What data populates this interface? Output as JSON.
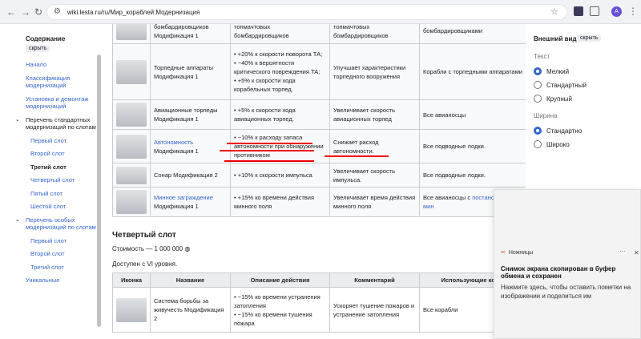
{
  "browser": {
    "url": "wiki.lesta.ru/ru/Мир_кораблей:Модернизация",
    "profile": "A"
  },
  "sidebar": {
    "title": "Содержание",
    "hide": "скрыть",
    "items": [
      "Начало",
      "Классификация модернизаций",
      "Установка и демонтаж модернизаций",
      "Перечень стандартных модернизаций по слотам",
      "Первый слот",
      "Второй слот",
      "Третий слот",
      "Четвертый слот",
      "Пятый слот",
      "Шестой слот",
      "Перечень особых модернизаций по слотам",
      "Первый слот",
      "Второй слот",
      "Третий слот",
      "Уникальные"
    ]
  },
  "table1": {
    "rows": [
      {
        "name": "бомбардировщиков Модификация 1",
        "desc": [
          "топмачтовых бомбардировщиков"
        ],
        "comment": "топмачтовых бомбардировщиков",
        "usage": "бомбардировщиками"
      },
      {
        "name": "Торпедные аппараты Модификация 1",
        "desc": [
          "+20% к скорости поворота ТА;",
          "−40% к вероятности критического повреждения ТА;",
          "+5% к скорости хода корабельных торпед."
        ],
        "comment": "Улучшает характеристики торпедного вооружения",
        "usage": "Корабли с торпедными аппаратами"
      },
      {
        "name": "Авиационные торпеды Модификация 1",
        "desc": [
          "+5% к скорости хода авиационных торпед."
        ],
        "comment": "Увеличивает скорость авиационных торпед",
        "usage": "Все авианосцы"
      },
      {
        "name_link": "Автономность",
        "name": "Модификация 1",
        "desc": [
          "−10% к расходу запаса автономности при обнаружении противником"
        ],
        "comment": "Снижает расход автономности.",
        "usage": "Все подводные лодки."
      },
      {
        "name": "Сонар Модификация 2",
        "desc": [
          "+10% к скорости импульса"
        ],
        "comment": "Увеличивает скорость импульса.",
        "usage": "Все подводные лодки."
      },
      {
        "name_link": "Минное заграждение",
        "name": "Модификация 1",
        "desc": [
          "+15% ко времени действия минного поля"
        ],
        "comment": "Увеличивает время действия минного поля",
        "usage": "Все авианосцы с ",
        "usage_link": "постановщиками мин"
      }
    ]
  },
  "section": {
    "title": "Четвертый слот",
    "cost": "Стоимость — 1 000 000",
    "avail": "Доступен с VI уровня."
  },
  "table2": {
    "headers": [
      "Иконка",
      "Название",
      "Описание действия",
      "Комментарий",
      "Использующие корабли"
    ],
    "row": {
      "name": "Система борьбы за живучесть Модификация 2",
      "desc": [
        "−15% ко времени устранения затопления",
        "−15% ко времени тушения пожара"
      ],
      "comment": "Ускоряет тушение пожаров и устранение затопления",
      "usage": "Все корабли"
    }
  },
  "appearance": {
    "title": "Внешний вид",
    "hide": "скрыть",
    "text_label": "Текст",
    "text_opts": [
      "Мелкий",
      "Стандартный",
      "Крупный"
    ],
    "width_label": "Ширина",
    "width_opts": [
      "Стандартно",
      "Широко"
    ]
  },
  "toast": {
    "app": "Ножницы",
    "heading": "Снимок экрана скопирован в буфер обмена и сохранен",
    "body": "Нажмите здесь, чтобы оставить пометки на изображении и поделиться им"
  }
}
